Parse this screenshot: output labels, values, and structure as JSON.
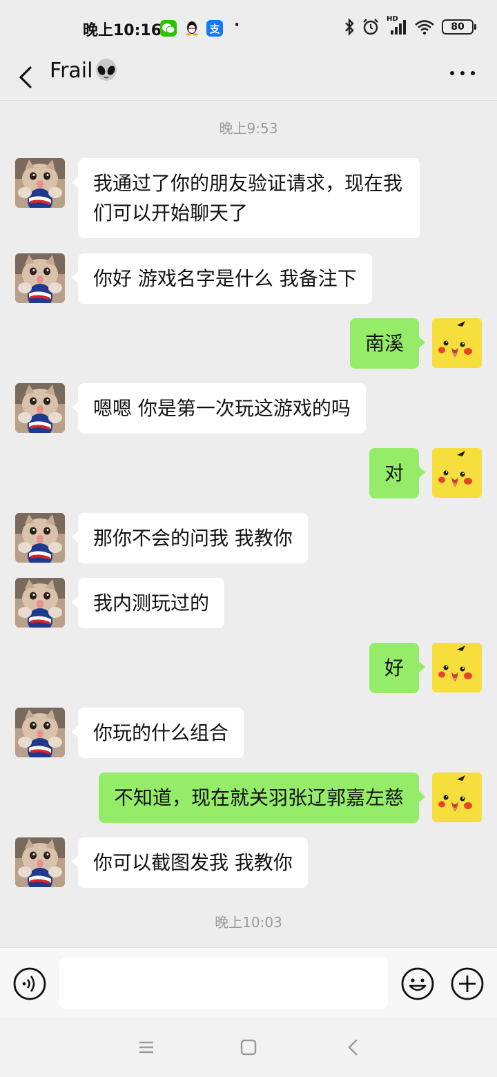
{
  "status_bar": {
    "time": "晚上10:16",
    "apps": [
      {
        "name": "wechat",
        "glyph": "",
        "color": "#2dc100"
      },
      {
        "name": "qq",
        "glyph": "",
        "color": "#ffffff"
      },
      {
        "name": "alipay",
        "glyph": "支",
        "color": "#1677ff"
      }
    ],
    "dot": "·",
    "network_label": "HD",
    "battery": "80"
  },
  "header": {
    "title": "Frail",
    "back_icon": "chevron-left-icon",
    "alien_icon": "alien-emoji-icon",
    "more_icon": "more-dots-icon"
  },
  "messages": {
    "timestamp1": "晚上9:53",
    "m1": "我通过了你的朋友验证请求，现在我们可以开始聊天了",
    "m2": "你好  游戏名字是什么 我备注下",
    "m3": "南溪",
    "m4": "嗯嗯 你是第一次玩这游戏的吗",
    "m5": "对",
    "m6": "那你不会的问我  我教你",
    "m7": "我内测玩过的",
    "m8": "好",
    "m9": "你玩的什么组合",
    "m10": "不知道，现在就关羽张辽郭嘉左慈",
    "m11": "你可以截图发我 我教你",
    "timestamp2": "晚上10:03"
  },
  "input_bar": {
    "input_value": "",
    "voice_icon": "voice-icon",
    "emoji_icon": "emoji-icon",
    "plus_icon": "plus-icon"
  },
  "colors": {
    "background": "#ededed",
    "my_bubble": "#95ec69",
    "their_bubble": "#ffffff"
  }
}
